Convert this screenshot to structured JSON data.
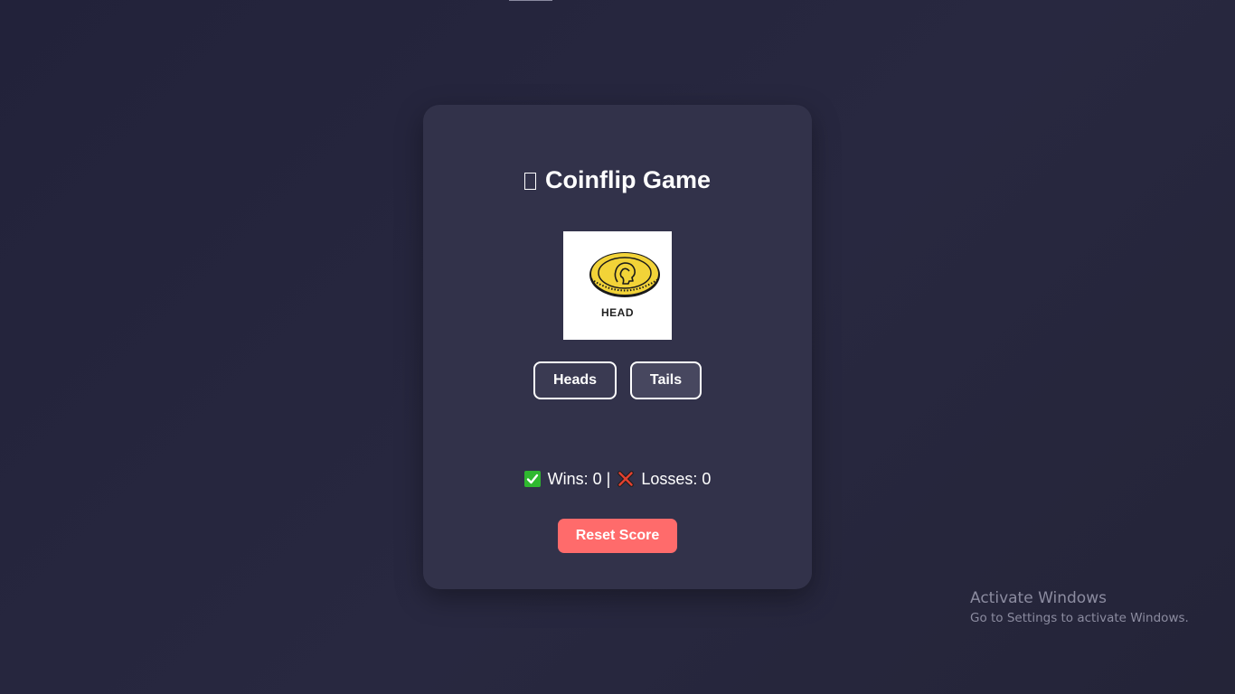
{
  "game": {
    "title": "Coinflip Game",
    "title_icon": "missing-glyph-icon",
    "coin": {
      "face_label": "HEAD",
      "icon": "coin-head-icon",
      "colors": {
        "coin": "#f2d338",
        "outline": "#1a1a1a"
      }
    },
    "buttons": {
      "heads_label": "Heads",
      "tails_label": "Tails",
      "reset_label": "Reset Score"
    },
    "score": {
      "wins_label": "Wins: 0",
      "separator": "|",
      "losses_label": "Losses: 0",
      "wins_icon": "check-mark-icon",
      "losses_icon": "cross-mark-icon"
    }
  },
  "watermark": {
    "title": "Activate Windows",
    "subtitle": "Go to Settings to activate Windows."
  },
  "colors": {
    "background": "#262639",
    "card": "#32324a",
    "reset_button": "#ff6b6b",
    "choice_button": "#47475f",
    "win_green": "#2fb82f",
    "loss_red": "#e0402f"
  }
}
